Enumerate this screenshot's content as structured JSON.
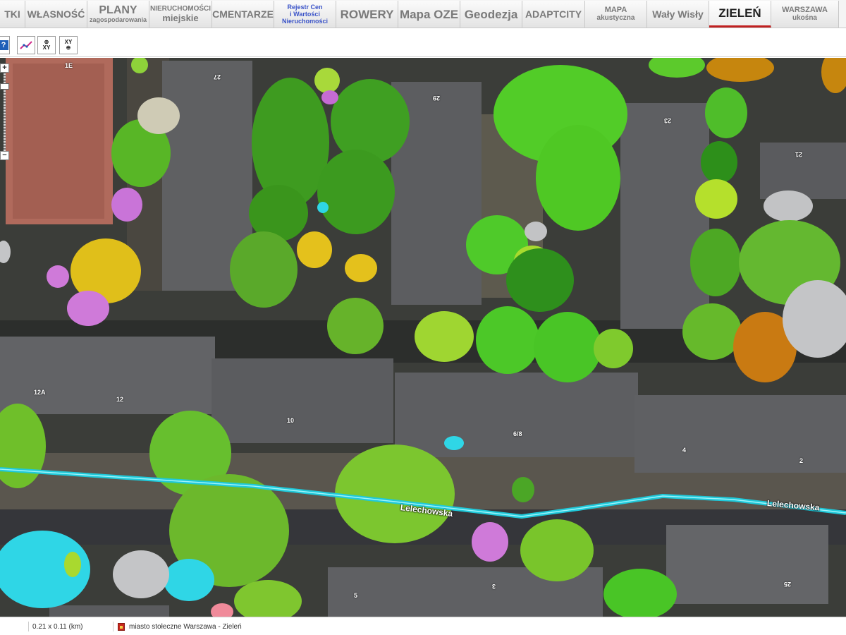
{
  "tabs": [
    {
      "id": "tki",
      "l1": "TKI",
      "style": "t-mid",
      "w": 36
    },
    {
      "id": "wlasnosc",
      "l1": "WŁASNOŚĆ",
      "style": "t-mid",
      "w": 88
    },
    {
      "id": "plany",
      "l1": "PLANY",
      "l2": "zagospodarowania",
      "style": "t-stack",
      "w": 88
    },
    {
      "id": "nieruchomosci",
      "l1": "NIERUCHOMOŚCI",
      "l2": "miejskie",
      "style": "t-stack2",
      "w": 89
    },
    {
      "id": "cmentarze",
      "l1": "CMENTARZE",
      "style": "t-mid",
      "w": 88
    },
    {
      "id": "rejestr",
      "l1": "Rejestr Cen",
      "l2": "i Wartości",
      "l3": "Nieruchomości",
      "style": "t-reg",
      "w": 88
    },
    {
      "id": "rowery",
      "l1": "ROWERY",
      "style": "t-big",
      "w": 88
    },
    {
      "id": "mapa-oze",
      "l1": "Mapa OZE",
      "style": "t-big",
      "w": 88
    },
    {
      "id": "geodezja",
      "l1": "Geodezja",
      "style": "t-big",
      "w": 88
    },
    {
      "id": "adaptcity",
      "l1": "ADAPTCITY",
      "style": "t-mid",
      "w": 89
    },
    {
      "id": "mapa-akustyczna",
      "l1": "MAPA",
      "l2": "akustyczna",
      "style": "t-stack3",
      "w": 88
    },
    {
      "id": "waly-wisly",
      "l1": "Wały Wisły",
      "style": "t-mid",
      "w": 88
    },
    {
      "id": "zielen",
      "l1": "ZIELEŃ",
      "style": "t-big",
      "w": 88,
      "active": true
    },
    {
      "id": "warszawa-ukosna",
      "l1": "WARSZAWA",
      "l2": "ukośna",
      "style": "t-stack3",
      "w": 96
    }
  ],
  "toolbar": {
    "help_icon": "help-icon",
    "measure_icon": "measure-line-icon",
    "xy_label": "XY",
    "xy2_label": "XY"
  },
  "map": {
    "street_labels": [
      "Lelechowska",
      "Lelechowska"
    ],
    "building_numbers": [
      "1E",
      "27",
      "29",
      "23",
      "21",
      "12A",
      "12",
      "10",
      "6/8",
      "4",
      "2",
      "3",
      "5",
      "25"
    ],
    "zoom": {
      "plus": "+",
      "minus": "−",
      "level": 0.14
    }
  },
  "status": {
    "scale": "0.21 x 0.11 (km)",
    "layer": "miasto stołeczne Warszawa - Zieleń"
  },
  "colors": {
    "accent_active": "#c02020",
    "street_line": "#29d3e4",
    "tree_green": "#58c42a",
    "tree_dark": "#2f8f1a",
    "tree_yellow": "#e2c01e",
    "tree_violet": "#cf84dc",
    "tree_orange": "#c27a12",
    "tree_cyan": "#2fd6e6"
  }
}
